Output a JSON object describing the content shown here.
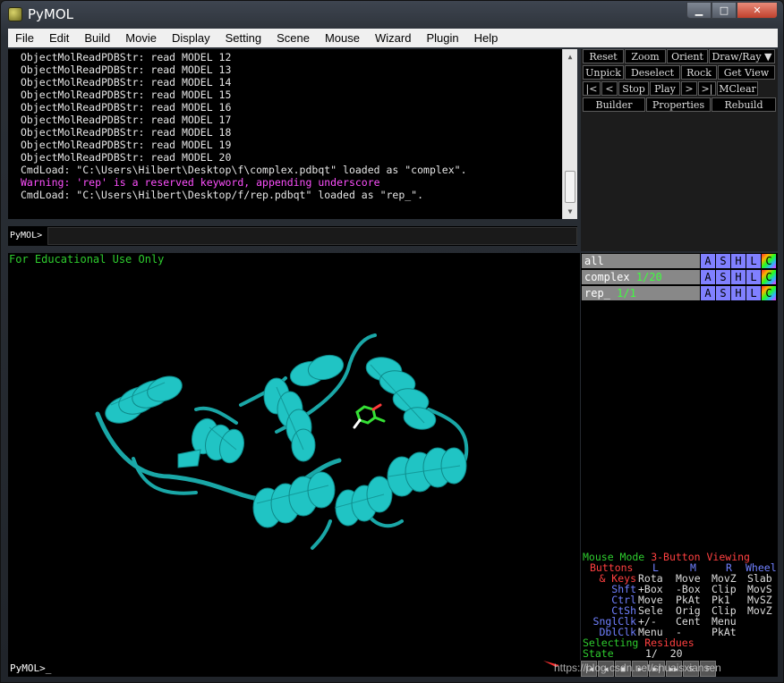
{
  "window": {
    "title": "PyMOL",
    "min_label": "▁",
    "max_label": "□",
    "close_label": "✕"
  },
  "menu": [
    "File",
    "Edit",
    "Build",
    "Movie",
    "Display",
    "Setting",
    "Scene",
    "Mouse",
    "Wizard",
    "Plugin",
    "Help"
  ],
  "output_lines": [
    {
      "text": "ObjectMolReadPDBStr: read MODEL 12",
      "warn": false
    },
    {
      "text": "ObjectMolReadPDBStr: read MODEL 13",
      "warn": false
    },
    {
      "text": "ObjectMolReadPDBStr: read MODEL 14",
      "warn": false
    },
    {
      "text": "ObjectMolReadPDBStr: read MODEL 15",
      "warn": false
    },
    {
      "text": "ObjectMolReadPDBStr: read MODEL 16",
      "warn": false
    },
    {
      "text": "ObjectMolReadPDBStr: read MODEL 17",
      "warn": false
    },
    {
      "text": "ObjectMolReadPDBStr: read MODEL 18",
      "warn": false
    },
    {
      "text": "ObjectMolReadPDBStr: read MODEL 19",
      "warn": false
    },
    {
      "text": "ObjectMolReadPDBStr: read MODEL 20",
      "warn": false
    },
    {
      "text": "CmdLoad: \"C:\\Users\\Hilbert\\Desktop\\f\\complex.pdbqt\" loaded as \"complex\".",
      "warn": false
    },
    {
      "text": "Warning: 'rep' is a reserved keyword, appending underscore",
      "warn": true
    },
    {
      "text": "CmdLoad: \"C:\\Users\\Hilbert\\Desktop/f/rep.pdbqt\" loaded as \"rep_\".",
      "warn": false
    }
  ],
  "prompt_top": "PyMOL>",
  "prompt_bottom": "PyMOL>_",
  "control_rows": [
    [
      {
        "label": "Reset",
        "w": 46
      },
      {
        "label": "Zoom",
        "w": 46
      },
      {
        "label": "Orient",
        "w": 46
      },
      {
        "label": "Draw/Ray ▼",
        "w": 74
      }
    ],
    [
      {
        "label": "Unpick",
        "w": 46
      },
      {
        "label": "Deselect",
        "w": 62
      },
      {
        "label": "Rock",
        "w": 40
      },
      {
        "label": "Get View",
        "w": 64
      }
    ],
    [
      {
        "label": "|<",
        "w": 20
      },
      {
        "label": "<",
        "w": 18
      },
      {
        "label": "Stop",
        "w": 34
      },
      {
        "label": "Play",
        "w": 34
      },
      {
        "label": ">",
        "w": 18
      },
      {
        "label": ">|",
        "w": 20
      },
      {
        "label": "MClear",
        "w": 46
      }
    ],
    [
      {
        "label": "Builder",
        "w": 70
      },
      {
        "label": "Properties",
        "w": 72
      },
      {
        "label": "Rebuild",
        "w": 72
      }
    ]
  ],
  "viewer_caption": "For Educational Use Only",
  "objects": [
    {
      "name": "all",
      "state": ""
    },
    {
      "name": "complex",
      "state": "1/20"
    },
    {
      "name": "rep_",
      "state": "1/1"
    }
  ],
  "obj_buttons": [
    "A",
    "S",
    "H",
    "L",
    "C"
  ],
  "mouse_panel": {
    "mode_label": "Mouse Mode",
    "mode_value": "3-Button Viewing",
    "buttons_label": "Buttons",
    "col_L": "L",
    "col_M": "M",
    "col_R": "R",
    "col_W": "Wheel",
    "rows": [
      {
        "key": "& Keys",
        "vals": [
          "Rota",
          "Move",
          "MovZ",
          "Slab"
        ],
        "keycolor": "r"
      },
      {
        "key": "Shft",
        "vals": [
          "+Box",
          "-Box",
          "Clip",
          "MovS"
        ],
        "keycolor": "b"
      },
      {
        "key": "Ctrl",
        "vals": [
          "Move",
          "PkAt",
          "Pk1",
          "MvSZ"
        ],
        "keycolor": "b"
      },
      {
        "key": "CtSh",
        "vals": [
          "Sele",
          "Orig",
          "Clip",
          "MovZ"
        ],
        "keycolor": "b"
      },
      {
        "key": "SnglClk",
        "vals": [
          "+/-",
          "Cent",
          "Menu",
          ""
        ],
        "keycolor": "b"
      },
      {
        "key": "DblClk",
        "vals": [
          "Menu",
          "-",
          "PkAt",
          ""
        ],
        "keycolor": "b"
      }
    ],
    "selecting_label": "Selecting",
    "selecting_value": "Residues",
    "state_label": "State",
    "state_value": "1/  20"
  },
  "watermark": "https://blog.csdn.net/shuaisxiansen",
  "colors": {
    "cartoon": "#20c4c4",
    "ligand": "#35e035",
    "warning": "#ff50ff"
  }
}
